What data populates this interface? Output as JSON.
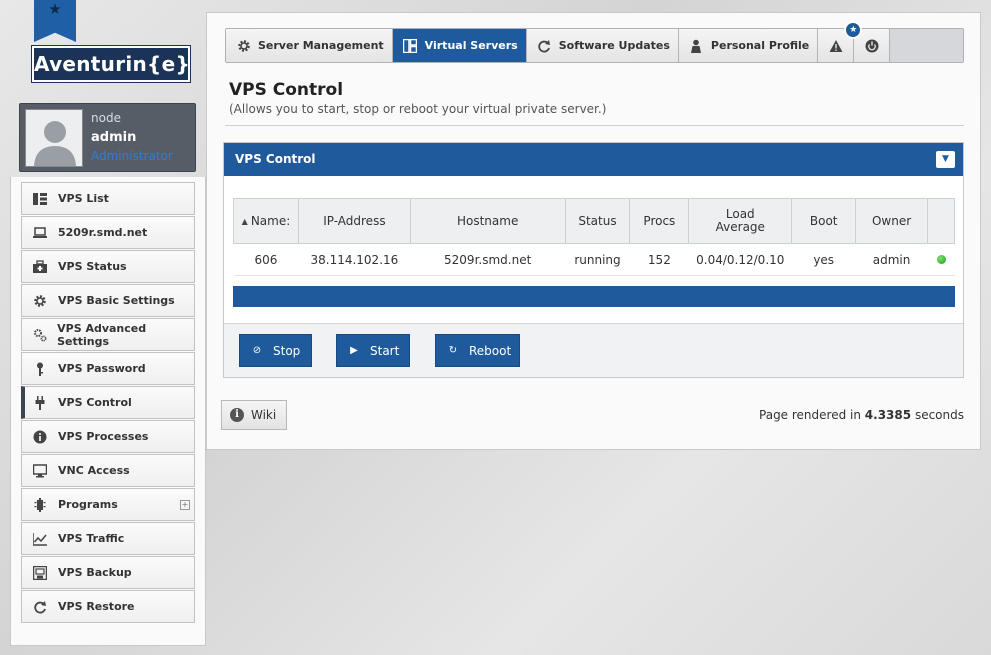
{
  "logo": {
    "text": "Aventurin{e}"
  },
  "user": {
    "node": "node",
    "name": "admin",
    "role": "Administrator"
  },
  "sidebar": {
    "items": [
      {
        "label": "VPS List",
        "icon": "list-icon"
      },
      {
        "label": "5209r.smd.net",
        "icon": "laptop-icon"
      },
      {
        "label": "VPS Status",
        "icon": "status-icon"
      },
      {
        "label": "VPS Basic Settings",
        "icon": "gear-icon"
      },
      {
        "label": "VPS Advanced Settings",
        "icon": "gears-icon"
      },
      {
        "label": "VPS Password",
        "icon": "key-icon"
      },
      {
        "label": "VPS Control",
        "icon": "plug-icon",
        "active": true
      },
      {
        "label": "VPS Processes",
        "icon": "info-icon"
      },
      {
        "label": "VNC Access",
        "icon": "monitor-icon"
      },
      {
        "label": "Programs",
        "icon": "chip-icon",
        "expandable": true
      },
      {
        "label": "VPS Traffic",
        "icon": "chart-icon"
      },
      {
        "label": "VPS Backup",
        "icon": "backup-icon"
      },
      {
        "label": "VPS Restore",
        "icon": "restore-icon"
      }
    ]
  },
  "tabs": [
    {
      "label": "Server Management",
      "icon": "gear-icon"
    },
    {
      "label": "Virtual Servers",
      "icon": "layout-icon",
      "active": true
    },
    {
      "label": "Software Updates",
      "icon": "refresh-icon"
    },
    {
      "label": "Personal Profile",
      "icon": "person-icon"
    }
  ],
  "page": {
    "title": "VPS Control",
    "subtitle": "(Allows you to start, stop or reboot your virtual private server.)"
  },
  "block": {
    "title": "VPS Control"
  },
  "table": {
    "headers": [
      "Name:",
      "IP-Address",
      "Hostname",
      "Status",
      "Procs",
      "Load Average",
      "Boot",
      "Owner",
      ""
    ],
    "rows": [
      {
        "name": "606",
        "ip": "38.114.102.16",
        "hostname": "5209r.smd.net",
        "status": "running",
        "procs": "152",
        "load": "0.04/0.12/0.10",
        "boot": "yes",
        "owner": "admin"
      }
    ]
  },
  "buttons": {
    "stop": "Stop",
    "start": "Start",
    "reboot": "Reboot"
  },
  "footer": {
    "wiki": "Wiki",
    "render_prefix": "Page rendered in",
    "render_time": "4.3385",
    "render_suffix": "seconds"
  },
  "colors": {
    "accent": "#1f5b9c",
    "header_dark": "#1a3357",
    "status_ok": "#1a9a12"
  }
}
